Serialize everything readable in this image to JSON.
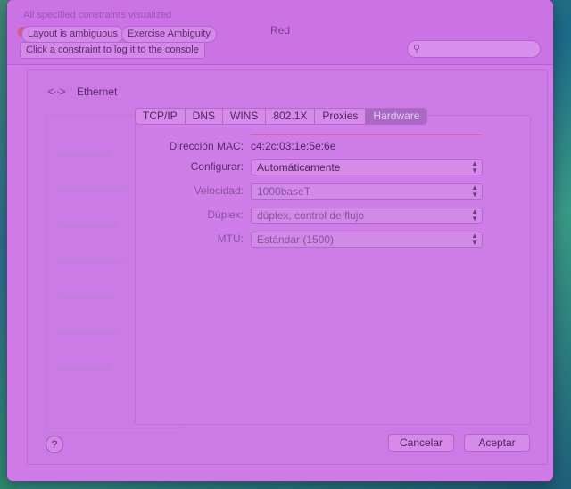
{
  "debug": {
    "note": "All specified constraints visualized",
    "status": "Layout is ambiguous",
    "button": "Exercise Ambiguity",
    "hint": "Click a constraint to log it to the console"
  },
  "window": {
    "title": "Red"
  },
  "search": {
    "placeholder": "",
    "icon": "magnifier"
  },
  "service": {
    "icon": "ethernet-arrows",
    "label": "Ethernet"
  },
  "tabs": [
    {
      "label": "TCP/IP"
    },
    {
      "label": "DNS"
    },
    {
      "label": "WINS"
    },
    {
      "label": "802.1X"
    },
    {
      "label": "Proxies"
    },
    {
      "label": "Hardware",
      "active": true
    }
  ],
  "hardware": {
    "mac_label": "Dirección MAC:",
    "mac_value": "c4:2c:03:1e:5e:6e",
    "configure_label": "Configurar:",
    "configure_value": "Automáticamente",
    "speed_label": "Velocidad:",
    "speed_value": "1000baseT",
    "duplex_label": "Dúplex:",
    "duplex_value": "dúplex, control de flujo",
    "mtu_label": "MTU:",
    "mtu_value": "Estándar  (1500)"
  },
  "footer": {
    "help": "?",
    "cancel": "Cancelar",
    "accept": "Aceptar"
  },
  "colors": {
    "overlay": "#cf7ae7",
    "active_tab": "#a868c4",
    "constraint_line": "#e06090"
  }
}
